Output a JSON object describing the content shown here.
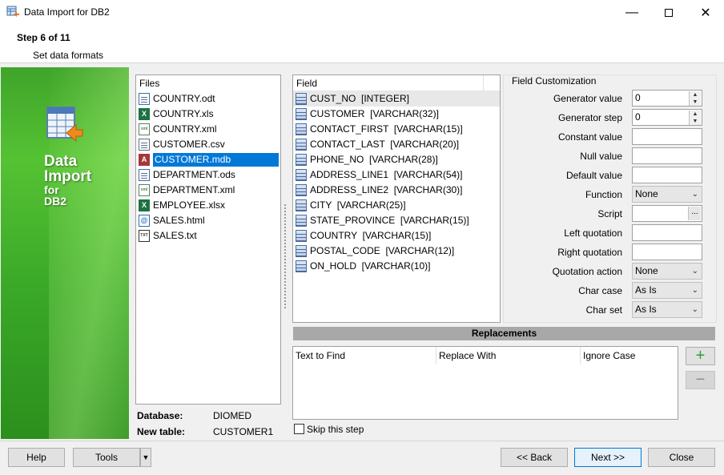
{
  "window": {
    "title": "Data Import for DB2"
  },
  "header": {
    "step": "Step 6 of 11",
    "subtitle": "Set data formats"
  },
  "banner": {
    "line1": "Data",
    "line2": "Import",
    "line3": "for",
    "line4": "DB2"
  },
  "files": {
    "header": "Files",
    "items": [
      "COUNTRY.odt",
      "COUNTRY.xls",
      "COUNTRY.xml",
      "CUSTOMER.csv",
      "CUSTOMER.mdb",
      "DEPARTMENT.ods",
      "DEPARTMENT.xml",
      "EMPLOYEE.xlsx",
      "SALES.html",
      "SALES.txt"
    ],
    "selected": "CUSTOMER.mdb"
  },
  "database": {
    "label": "Database:",
    "value": "DIOMED"
  },
  "new_table": {
    "label": "New table:",
    "value": "CUSTOMER1"
  },
  "fields": {
    "header": "Field",
    "items": [
      "CUST_NO  [INTEGER]",
      "CUSTOMER  [VARCHAR(32)]",
      "CONTACT_FIRST  [VARCHAR(15)]",
      "CONTACT_LAST  [VARCHAR(20)]",
      "PHONE_NO  [VARCHAR(28)]",
      "ADDRESS_LINE1  [VARCHAR(54)]",
      "ADDRESS_LINE2  [VARCHAR(30)]",
      "CITY  [VARCHAR(25)]",
      "STATE_PROVINCE  [VARCHAR(15)]",
      "COUNTRY  [VARCHAR(15)]",
      "POSTAL_CODE  [VARCHAR(12)]",
      "ON_HOLD  [VARCHAR(10)]"
    ]
  },
  "field_customization": {
    "title": "Field Customization",
    "generator_value": {
      "label": "Generator value",
      "value": "0"
    },
    "generator_step": {
      "label": "Generator step",
      "value": "0"
    },
    "constant_value": {
      "label": "Constant value",
      "value": ""
    },
    "null_value": {
      "label": "Null value",
      "value": ""
    },
    "default_value": {
      "label": "Default value",
      "value": ""
    },
    "function": {
      "label": "Function",
      "value": "None"
    },
    "script": {
      "label": "Script",
      "value": "",
      "button": "..."
    },
    "left_quotation": {
      "label": "Left quotation",
      "value": ""
    },
    "right_quotation": {
      "label": "Right quotation",
      "value": ""
    },
    "quotation_action": {
      "label": "Quotation action",
      "value": "None"
    },
    "char_case": {
      "label": "Char case",
      "value": "As Is"
    },
    "char_set": {
      "label": "Char set",
      "value": "As Is"
    }
  },
  "replacements": {
    "title": "Replacements",
    "columns": [
      "Text to Find",
      "Replace With",
      "Ignore Case"
    ],
    "add_label": "+",
    "remove_label": "−"
  },
  "skip_step": {
    "label": "Skip this step",
    "checked": false
  },
  "footer": {
    "help": "Help",
    "tools": "Tools",
    "back": "<< Back",
    "next": "Next >>",
    "close": "Close"
  },
  "colors": {
    "selection": "#0078d7",
    "banner_green": "#3fa42a",
    "add_icon": "#2e9e3a"
  }
}
